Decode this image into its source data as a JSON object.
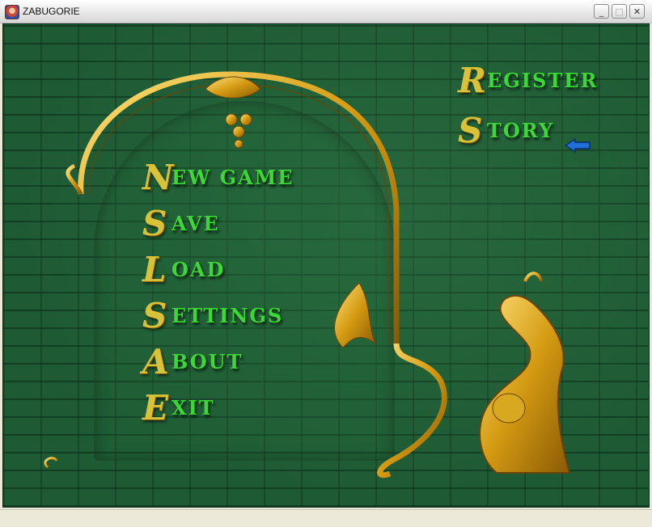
{
  "window": {
    "title": "ZABUGORIE"
  },
  "main_menu": [
    {
      "cap": "N",
      "rest": "ew game"
    },
    {
      "cap": "S",
      "rest": "ave"
    },
    {
      "cap": "L",
      "rest": "oad"
    },
    {
      "cap": "S",
      "rest": "ettings"
    },
    {
      "cap": "A",
      "rest": "bout"
    },
    {
      "cap": "E",
      "rest": "xit"
    }
  ],
  "side_menu": [
    {
      "cap": "R",
      "rest": "egister"
    },
    {
      "cap": "S",
      "rest": "tory"
    }
  ],
  "colors": {
    "background": "#1e5a34",
    "gold": "#d8a820",
    "menu_text": "#3fd63a",
    "cursor": "#1f6fd6"
  },
  "icons": {
    "cursor": "pointing-hand-arrow-icon",
    "app": "app-icon"
  }
}
